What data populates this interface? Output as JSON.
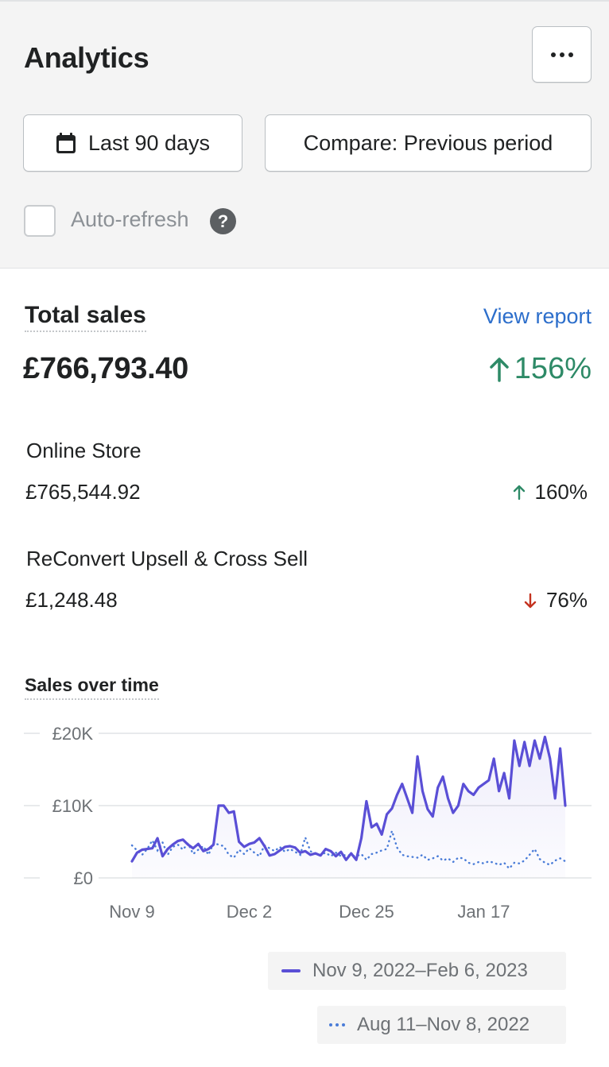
{
  "header": {
    "title": "Analytics",
    "more_icon": "horizontal-dots-icon"
  },
  "filters": {
    "date_range_label": "Last 90 days",
    "date_icon": "calendar-icon",
    "compare_label": "Compare: Previous period"
  },
  "auto_refresh": {
    "label": "Auto-refresh",
    "checked": false,
    "help_icon": "question-circle-icon",
    "help_text": "?"
  },
  "total_sales": {
    "title": "Total sales",
    "view_report": "View report",
    "value": "£766,793.40",
    "change": "156%",
    "change_direction": "up",
    "change_color": "#2e8a67"
  },
  "channels": [
    {
      "name": "Online Store",
      "value": "£765,544.92",
      "change": "160%",
      "direction": "up"
    },
    {
      "name": "ReConvert Upsell & Cross Sell",
      "value": "£1,248.48",
      "change": "76%",
      "direction": "down"
    }
  ],
  "colors": {
    "up": "#2e8a67",
    "down": "#c4321f",
    "link": "#2c6ecb",
    "current_series": "#5a4fd6",
    "previous_series": "#4a7cd8"
  },
  "chart_title": "Sales over time",
  "chart_data": {
    "type": "line",
    "ylim": [
      0,
      20000
    ],
    "y_ticks": [
      {
        "value": 20000,
        "label": "£20K"
      },
      {
        "value": 10000,
        "label": "£10K"
      },
      {
        "value": 0,
        "label": "£0"
      }
    ],
    "x_ticks": [
      {
        "index": 0,
        "label": "Nov 9"
      },
      {
        "index": 23,
        "label": "Dec 2"
      },
      {
        "index": 46,
        "label": "Dec 25"
      },
      {
        "index": 69,
        "label": "Jan 17"
      }
    ],
    "grid": true,
    "legend_placement": "bottom-right",
    "series": [
      {
        "name": "Nov 9, 2022–Feb 6, 2023",
        "style": "solid",
        "values": [
          2300,
          3500,
          3900,
          4000,
          4100,
          5500,
          3000,
          4000,
          4600,
          5100,
          5300,
          4600,
          4100,
          4700,
          3700,
          4000,
          4600,
          10000,
          10000,
          9000,
          9200,
          5000,
          4300,
          4700,
          4900,
          5500,
          4400,
          3100,
          3300,
          3800,
          4300,
          4400,
          4200,
          3500,
          3700,
          3200,
          3400,
          3100,
          4000,
          3700,
          3000,
          3600,
          2500,
          3400,
          2500,
          5500,
          10600,
          7000,
          7500,
          6000,
          8800,
          9600,
          11500,
          13000,
          11000,
          9000,
          16800,
          12000,
          9500,
          8500,
          12500,
          14000,
          11000,
          9000,
          10000,
          13000,
          12000,
          11500,
          12500,
          13000,
          13500,
          16500,
          12000,
          14500,
          11000,
          19000,
          15500,
          18800,
          15500,
          19000,
          16500,
          19500,
          16500,
          11000,
          17900,
          10000
        ],
        "color": "#5a4fd6"
      },
      {
        "name": "Aug 11–Nov 8, 2022",
        "style": "dotted",
        "values": [
          4500,
          3800,
          3200,
          4000,
          5200,
          3800,
          4900,
          3200,
          4300,
          4600,
          3900,
          4800,
          3300,
          3900,
          4400,
          3200,
          4800,
          4600,
          4400,
          3200,
          2800,
          3900,
          3300,
          4100,
          3500,
          3000,
          4500,
          4100,
          3700,
          4300,
          3600,
          4000,
          3600,
          3200,
          5600,
          3700,
          3300,
          3200,
          3500,
          3000,
          3500,
          3000,
          3200,
          3100,
          3000,
          3300,
          2500,
          3300,
          3500,
          3800,
          4000,
          6500,
          4200,
          3200,
          3000,
          2900,
          2800,
          3200,
          2500,
          2700,
          3000,
          2400,
          2700,
          2200,
          2800,
          2700,
          2100,
          1900,
          2200,
          2000,
          2300,
          2100,
          1800,
          2100,
          1300,
          2100,
          2000,
          2400,
          3200,
          4000,
          2600,
          2100,
          1800,
          2400,
          2700,
          2300
        ]
      }
    ]
  }
}
